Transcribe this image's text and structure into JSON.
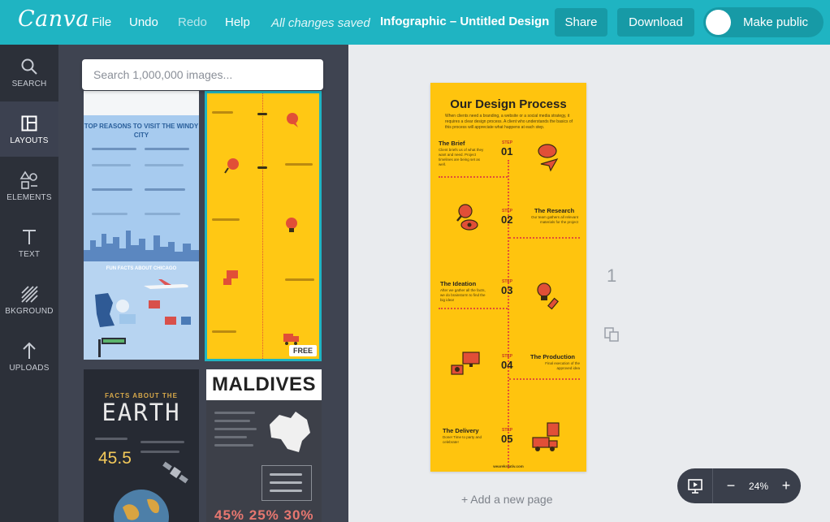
{
  "app": {
    "logo": "Canva"
  },
  "menu": {
    "file": "File",
    "undo": "Undo",
    "redo": "Redo",
    "help": "Help"
  },
  "status": {
    "saved": "All changes saved"
  },
  "document": {
    "title": "Infographic – Untitled Design"
  },
  "actions": {
    "share": "Share",
    "download": "Download",
    "make_public": "Make public"
  },
  "sidebar": {
    "items": [
      {
        "label": "SEARCH",
        "icon": "search-icon"
      },
      {
        "label": "LAYOUTS",
        "icon": "layouts-icon",
        "active": true
      },
      {
        "label": "ELEMENTS",
        "icon": "elements-icon"
      },
      {
        "label": "TEXT",
        "icon": "text-icon"
      },
      {
        "label": "BKGROUND",
        "icon": "background-icon"
      },
      {
        "label": "UPLOADS",
        "icon": "upload-icon"
      }
    ]
  },
  "panel": {
    "search_placeholder": "Search 1,000,000 images...",
    "templates": [
      {
        "heading": "TOP REASONS TO VISIT THE WINDY CITY",
        "subheading": "FUN FACTS ABOUT CHICAGO"
      },
      {
        "badge": "FREE"
      },
      {
        "kicker": "FACTS ABOUT THE",
        "big": "EARTH",
        "stat": "45.5"
      },
      {
        "heading": "MALDIVES",
        "stat": "45% 25% 30%"
      }
    ]
  },
  "page": {
    "title": "Our Design Process",
    "intro": "When clients need a branding, a website or a social media strategy, it requires a clear design process. A client who understands the basics of this process will appreciate what happens at each step.",
    "steps": [
      {
        "label": "STEP",
        "num": "01",
        "name": "The Brief",
        "desc": "Client briefs us of what they want and need. Project timelines are being set as well."
      },
      {
        "label": "STEP",
        "num": "02",
        "name": "The Research",
        "desc": "Our team gathers all relevant materials for the project"
      },
      {
        "label": "STEP",
        "num": "03",
        "name": "The Ideation",
        "desc": "After we gather all the facts, we do brainstorm to find the big idea!"
      },
      {
        "label": "STEP",
        "num": "04",
        "name": "The Production",
        "desc": "Final execution of the approved idea"
      },
      {
        "label": "STEP",
        "num": "05",
        "name": "The Delivery",
        "desc": "Done! Time to party and celebrate!"
      }
    ],
    "footer": "wearekreativ.com",
    "number": "1"
  },
  "canvas": {
    "add_page": "+ Add a new page"
  },
  "zoom": {
    "value": "24%",
    "minus": "−",
    "plus": "+"
  },
  "colors": {
    "brand": "#1fb4c2",
    "page_bg": "#ffc40e",
    "accent": "#e14f37"
  }
}
